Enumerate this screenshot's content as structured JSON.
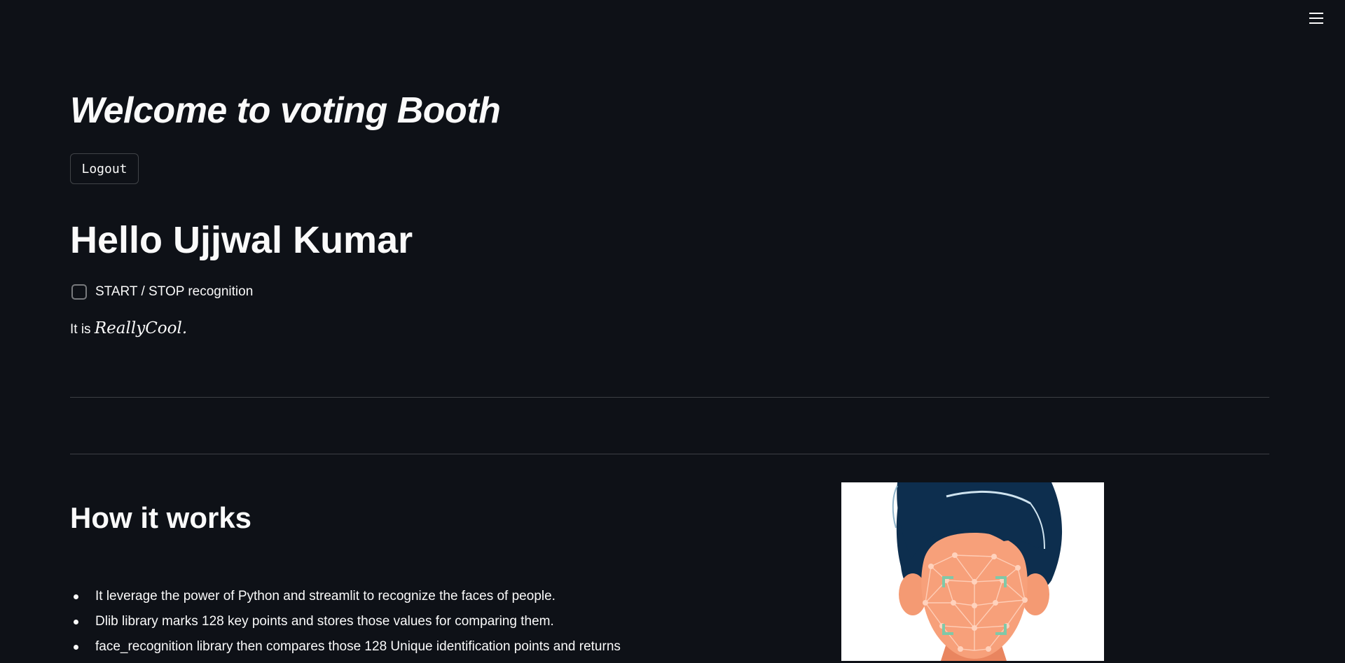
{
  "header": {
    "menu_icon": "hamburger-menu-icon"
  },
  "main": {
    "title": "Welcome to voting Booth",
    "logout_label": "Logout",
    "greeting": "Hello Ujjwal Kumar",
    "recognition_checkbox": {
      "label": "START / STOP recognition",
      "checked": false
    },
    "cool_prefix": "It is ",
    "cool_math": "ReallyCool",
    "cool_suffix": "."
  },
  "how_it_works": {
    "title": "How it works",
    "bullets": [
      "It leverage the power of Python and streamlit to recognize the faces of people.",
      "Dlib library marks 128 key points and stores those values for comparing them.",
      "face_recognition library then compares those 128 Unique identification points and returns"
    ],
    "illustration_icon": "face-recognition-illustration"
  },
  "colors": {
    "background": "#0e1117",
    "text": "#fafafa",
    "hair": "#0d2e4e",
    "skin": "#f7a07a",
    "scan_corner": "#7fc9a8"
  }
}
